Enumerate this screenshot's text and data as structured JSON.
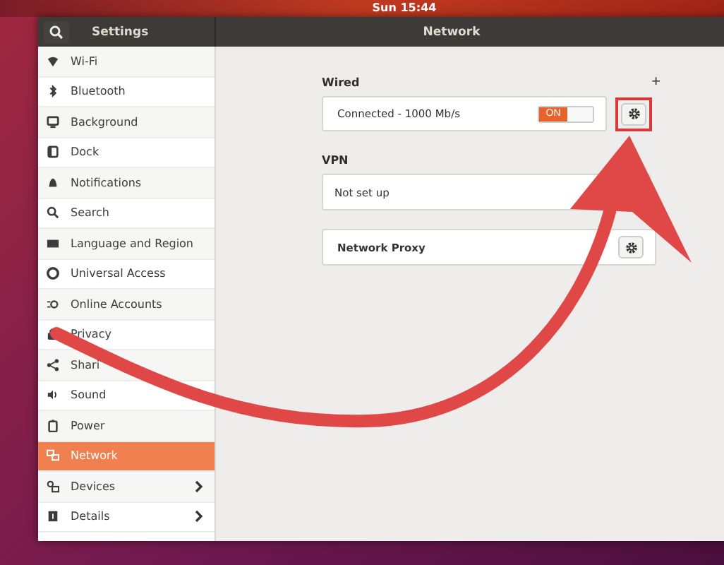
{
  "top_bar": {
    "clock": "Sun 15:44"
  },
  "window": {
    "title": "Settings",
    "panel_title": "Network"
  },
  "sidebar": {
    "items": [
      {
        "label": "Wi-Fi",
        "selected": false,
        "submenu": false
      },
      {
        "label": "Bluetooth",
        "selected": false,
        "submenu": false
      },
      {
        "label": "Background",
        "selected": false,
        "submenu": false
      },
      {
        "label": "Dock",
        "selected": false,
        "submenu": false
      },
      {
        "label": "Notifications",
        "selected": false,
        "submenu": false
      },
      {
        "label": "Search",
        "selected": false,
        "submenu": false
      },
      {
        "label": "Language and Region",
        "selected": false,
        "submenu": false
      },
      {
        "label": "Universal Access",
        "selected": false,
        "submenu": false
      },
      {
        "label": "Online Accounts",
        "selected": false,
        "submenu": false
      },
      {
        "label": "Privacy",
        "selected": false,
        "submenu": false
      },
      {
        "label": "Shari",
        "selected": false,
        "submenu": false
      },
      {
        "label": "Sound",
        "selected": false,
        "submenu": false
      },
      {
        "label": "Power",
        "selected": false,
        "submenu": false
      },
      {
        "label": "Network",
        "selected": true,
        "submenu": false
      },
      {
        "label": "Devices",
        "selected": false,
        "submenu": true
      },
      {
        "label": "Details",
        "selected": false,
        "submenu": true
      }
    ]
  },
  "wired": {
    "heading": "Wired",
    "add": "+",
    "status": "Connected - 1000 Mb/s",
    "switch": {
      "label": "ON",
      "on": true
    },
    "highlighted": true
  },
  "vpn": {
    "heading": "VPN",
    "status": "Not set up"
  },
  "proxy": {
    "label": "Network Proxy"
  }
}
